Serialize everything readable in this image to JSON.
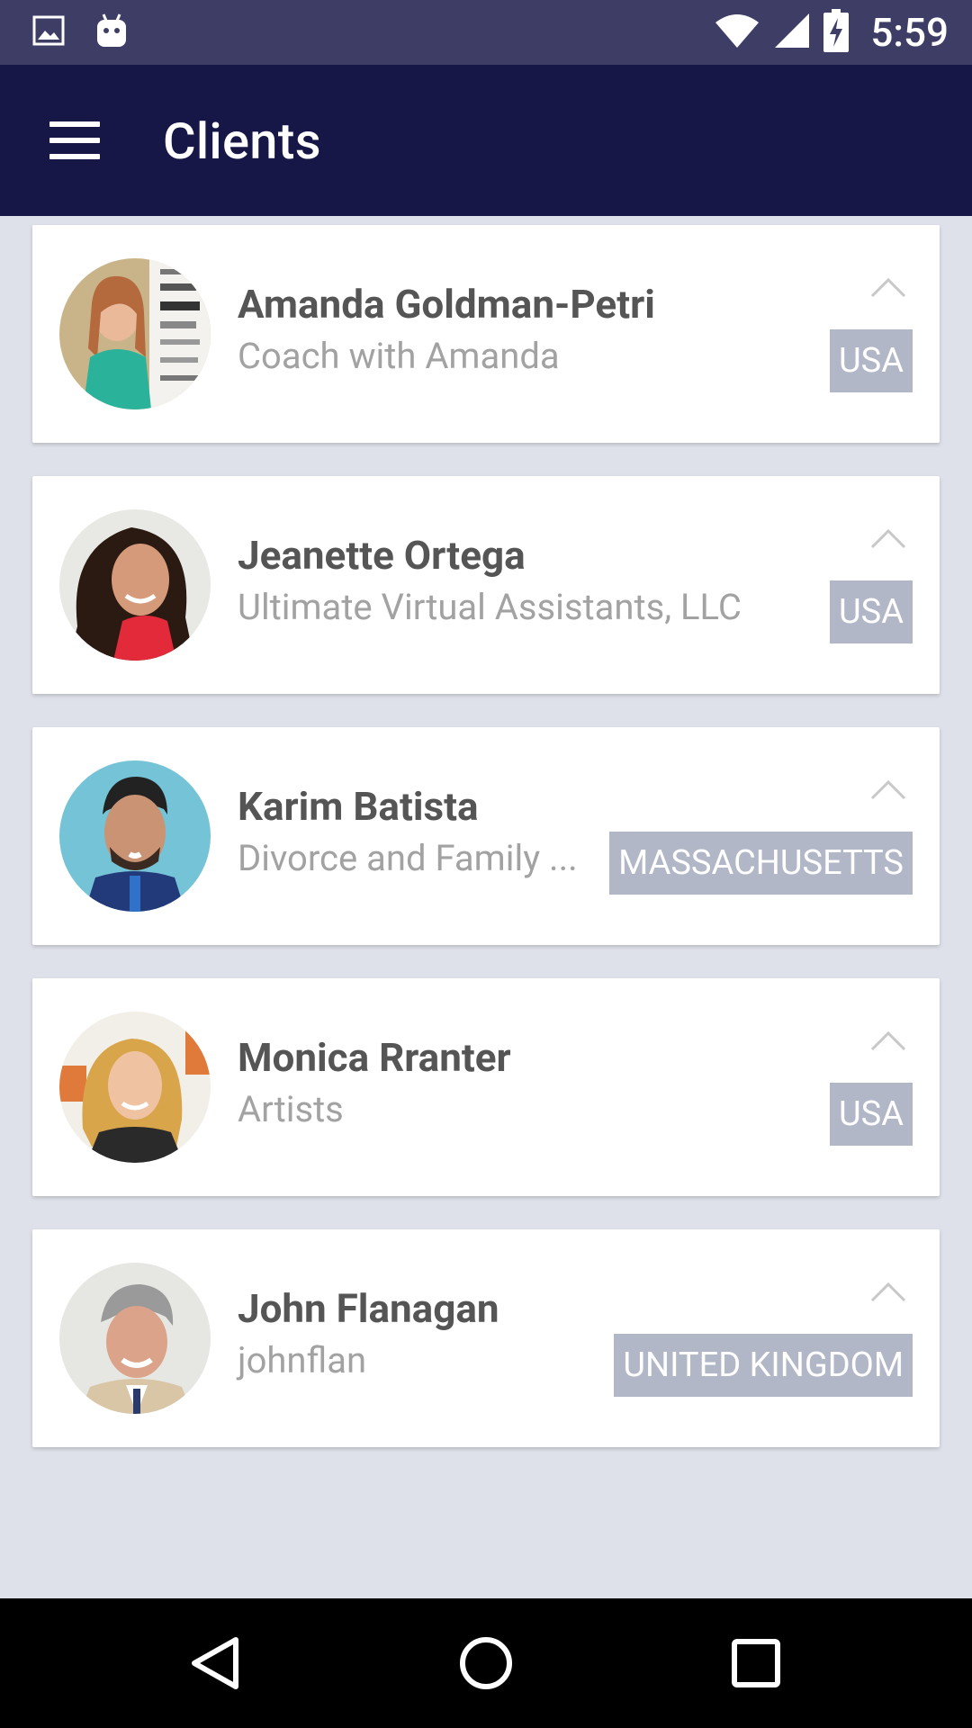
{
  "status_bar": {
    "time": "5:59",
    "left_icons": [
      "image-icon",
      "android-icon"
    ],
    "right_icons": [
      "wifi-icon",
      "cellular-signal-icon",
      "battery-charging-icon"
    ]
  },
  "app_bar": {
    "title": "Clients",
    "menu_icon": "hamburger-menu-icon"
  },
  "clients": [
    {
      "name": "Amanda Goldman-Petri",
      "company": "Coach with Amanda",
      "location": "USA"
    },
    {
      "name": "Jeanette Ortega",
      "company": "Ultimate Virtual Assistants, LLC",
      "location": "USA"
    },
    {
      "name": "Karim Batista",
      "company": "Divorce and Family ...",
      "location": "MASSACHUSETTS"
    },
    {
      "name": "Monica Rranter",
      "company": "Artists",
      "location": "USA"
    },
    {
      "name": "John Flanagan",
      "company": "johnflan",
      "location": "UNITED KINGDOM"
    }
  ],
  "nav_bar": {
    "buttons": [
      "back-icon",
      "home-icon",
      "recents-icon"
    ]
  },
  "colors": {
    "status_bar": "#3d3d66",
    "app_bar": "#161647",
    "background": "#dfe1ea",
    "badge": "#b2b7c7",
    "name_text": "#555555",
    "company_text": "#a2a2a2"
  }
}
